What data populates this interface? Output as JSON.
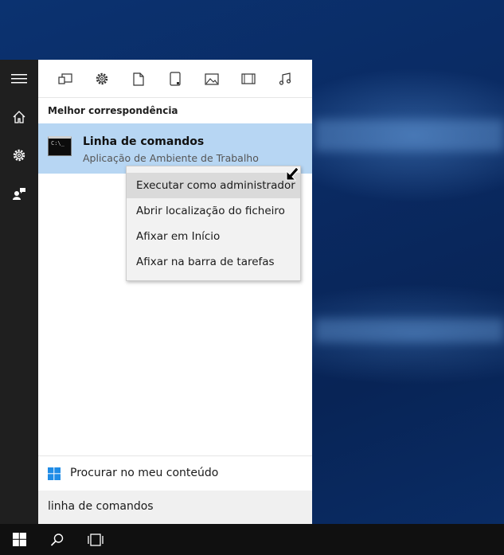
{
  "search_panel": {
    "filters": [
      {
        "name": "apps-filter-icon"
      },
      {
        "name": "settings-filter-icon"
      },
      {
        "name": "documents-filter-icon"
      },
      {
        "name": "folders-filter-icon"
      },
      {
        "name": "photos-filter-icon"
      },
      {
        "name": "videos-filter-icon"
      },
      {
        "name": "music-filter-icon"
      }
    ],
    "section_label": "Melhor correspondência",
    "best_match": {
      "title": "Linha de comandos",
      "subtitle": "Aplicação de Ambiente de Trabalho",
      "icon_text": "C:\\_"
    },
    "search_content_label": "Procurar no meu conteúdo",
    "search_query": "linha de comandos"
  },
  "context_menu": {
    "items": [
      {
        "label": "Executar como administrador",
        "hovered": true
      },
      {
        "label": "Abrir localização do ficheiro",
        "hovered": false
      },
      {
        "label": "Afixar em Início",
        "hovered": false
      },
      {
        "label": "Afixar na barra de tarefas",
        "hovered": false
      }
    ]
  },
  "colors": {
    "selection": "#b7d6f3",
    "rail": "#1f1f1f",
    "taskbar": "#101010",
    "windows_logo": "#1f8ce6"
  }
}
